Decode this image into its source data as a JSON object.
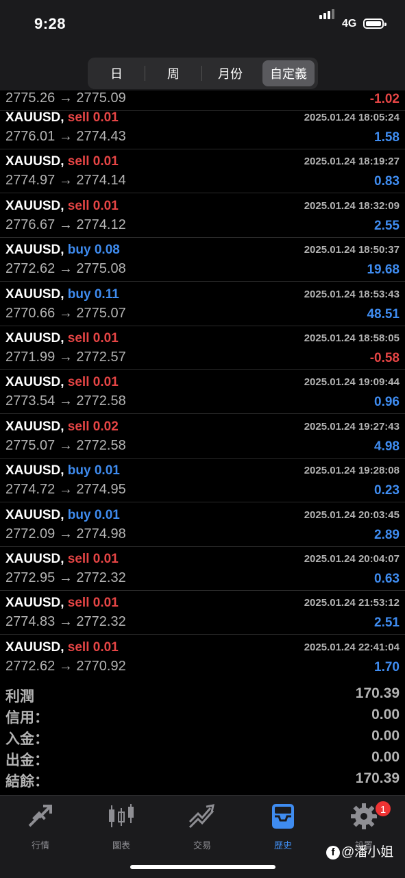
{
  "status": {
    "time": "9:28",
    "network": "4G"
  },
  "segments": [
    {
      "label": "日"
    },
    {
      "label": "周"
    },
    {
      "label": "月份"
    },
    {
      "label": "自定義"
    }
  ],
  "active_segment": "自定義",
  "partial_row": {
    "prices": "2775.26 → 2775.09",
    "pl": "-1.02"
  },
  "trades": [
    {
      "symbol": "XAUUSD,",
      "side": "sell",
      "volume": "0.01",
      "prices": "2776.01 → 2774.43",
      "time": "2025.01.24 18:05:24",
      "pl": "1.58"
    },
    {
      "symbol": "XAUUSD,",
      "side": "sell",
      "volume": "0.01",
      "prices": "2774.97 → 2774.14",
      "time": "2025.01.24 18:19:27",
      "pl": "0.83"
    },
    {
      "symbol": "XAUUSD,",
      "side": "sell",
      "volume": "0.01",
      "prices": "2776.67 → 2774.12",
      "time": "2025.01.24 18:32:09",
      "pl": "2.55"
    },
    {
      "symbol": "XAUUSD,",
      "side": "buy",
      "volume": "0.08",
      "prices": "2772.62 → 2775.08",
      "time": "2025.01.24 18:50:37",
      "pl": "19.68"
    },
    {
      "symbol": "XAUUSD,",
      "side": "buy",
      "volume": "0.11",
      "prices": "2770.66 → 2775.07",
      "time": "2025.01.24 18:53:43",
      "pl": "48.51"
    },
    {
      "symbol": "XAUUSD,",
      "side": "sell",
      "volume": "0.01",
      "prices": "2771.99 → 2772.57",
      "time": "2025.01.24 18:58:05",
      "pl": "-0.58"
    },
    {
      "symbol": "XAUUSD,",
      "side": "sell",
      "volume": "0.01",
      "prices": "2773.54 → 2772.58",
      "time": "2025.01.24 19:09:44",
      "pl": "0.96"
    },
    {
      "symbol": "XAUUSD,",
      "side": "sell",
      "volume": "0.02",
      "prices": "2775.07 → 2772.58",
      "time": "2025.01.24 19:27:43",
      "pl": "4.98"
    },
    {
      "symbol": "XAUUSD,",
      "side": "buy",
      "volume": "0.01",
      "prices": "2774.72 → 2774.95",
      "time": "2025.01.24 19:28:08",
      "pl": "0.23"
    },
    {
      "symbol": "XAUUSD,",
      "side": "buy",
      "volume": "0.01",
      "prices": "2772.09 → 2774.98",
      "time": "2025.01.24 20:03:45",
      "pl": "2.89"
    },
    {
      "symbol": "XAUUSD,",
      "side": "sell",
      "volume": "0.01",
      "prices": "2772.95 → 2772.32",
      "time": "2025.01.24 20:04:07",
      "pl": "0.63"
    },
    {
      "symbol": "XAUUSD,",
      "side": "sell",
      "volume": "0.01",
      "prices": "2774.83 → 2772.32",
      "time": "2025.01.24 21:53:12",
      "pl": "2.51"
    },
    {
      "symbol": "XAUUSD,",
      "side": "sell",
      "volume": "0.01",
      "prices": "2772.62 → 2770.92",
      "time": "2025.01.24 22:41:04",
      "pl": "1.70"
    }
  ],
  "summary": [
    {
      "label": "利潤",
      "value": "170.39"
    },
    {
      "label": "信用：",
      "value": "0.00"
    },
    {
      "label": "入金：",
      "value": "0.00"
    },
    {
      "label": "出金：",
      "value": "0.00"
    },
    {
      "label": "結餘：",
      "value": "170.39"
    }
  ],
  "tabs": [
    {
      "label": "行情",
      "icon": "quotes-arrows-icon"
    },
    {
      "label": "圖表",
      "icon": "candlestick-chart-icon"
    },
    {
      "label": "交易",
      "icon": "trade-trend-icon"
    },
    {
      "label": "歷史",
      "icon": "history-inbox-icon"
    },
    {
      "label": "設置",
      "icon": "gear-icon"
    }
  ],
  "active_tab": "歷史",
  "settings_badge": "1",
  "watermark": "@潘小姐",
  "colors": {
    "sell": "#e64545",
    "buy": "#3f8cf0",
    "loss": "#e64545",
    "profit": "#3f8cf0",
    "active_tab": "#3f8cf0"
  }
}
